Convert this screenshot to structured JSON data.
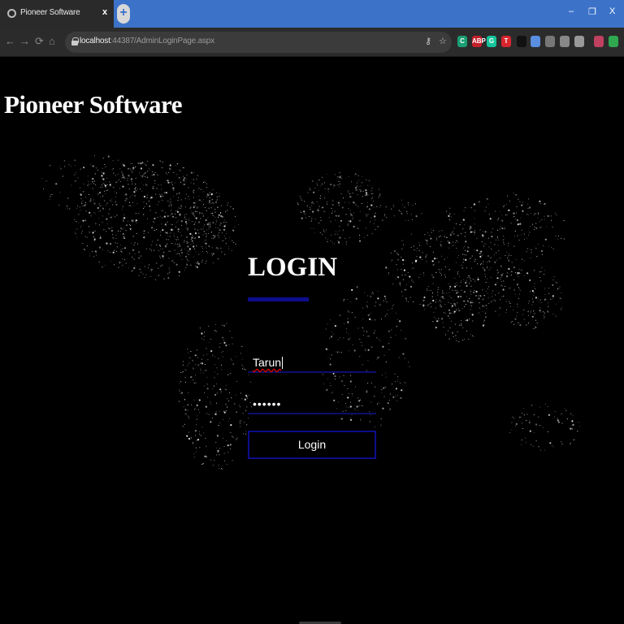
{
  "browser": {
    "tab_title": "Pioneer Software",
    "tab_close": "x",
    "new_tab": "+",
    "window_controls": [
      "–",
      "❐",
      "X"
    ],
    "url_host": "localhost",
    "url_rest": ":44387/AdminLoginPage.aspx",
    "icons": [
      "back-icon",
      "forward-icon",
      "reload-icon",
      "home-icon",
      "lock-icon",
      "key-icon",
      "star-icon"
    ],
    "extensions": [
      {
        "label": "C",
        "color": "#1a9e73"
      },
      {
        "label": "ABP",
        "color": "#c3202a"
      },
      {
        "label": "G",
        "color": "#15c39a"
      },
      {
        "label": "T",
        "color": "#d8242c"
      },
      {
        "label": "",
        "color": "#111111"
      },
      {
        "label": "",
        "color": "#5a8ee0"
      },
      {
        "label": "",
        "color": "#777777"
      },
      {
        "label": "",
        "color": "#888888"
      },
      {
        "label": "",
        "color": "#999999"
      },
      {
        "label": "",
        "color": "#c04060"
      },
      {
        "label": "",
        "color": "#2fa84f"
      }
    ]
  },
  "page": {
    "brand": "Pioneer Software",
    "login_title": "LOGIN",
    "username_value": "Tarun",
    "password_value": "••••••",
    "login_button": "Login",
    "accent_color": "#0d0d8c"
  }
}
